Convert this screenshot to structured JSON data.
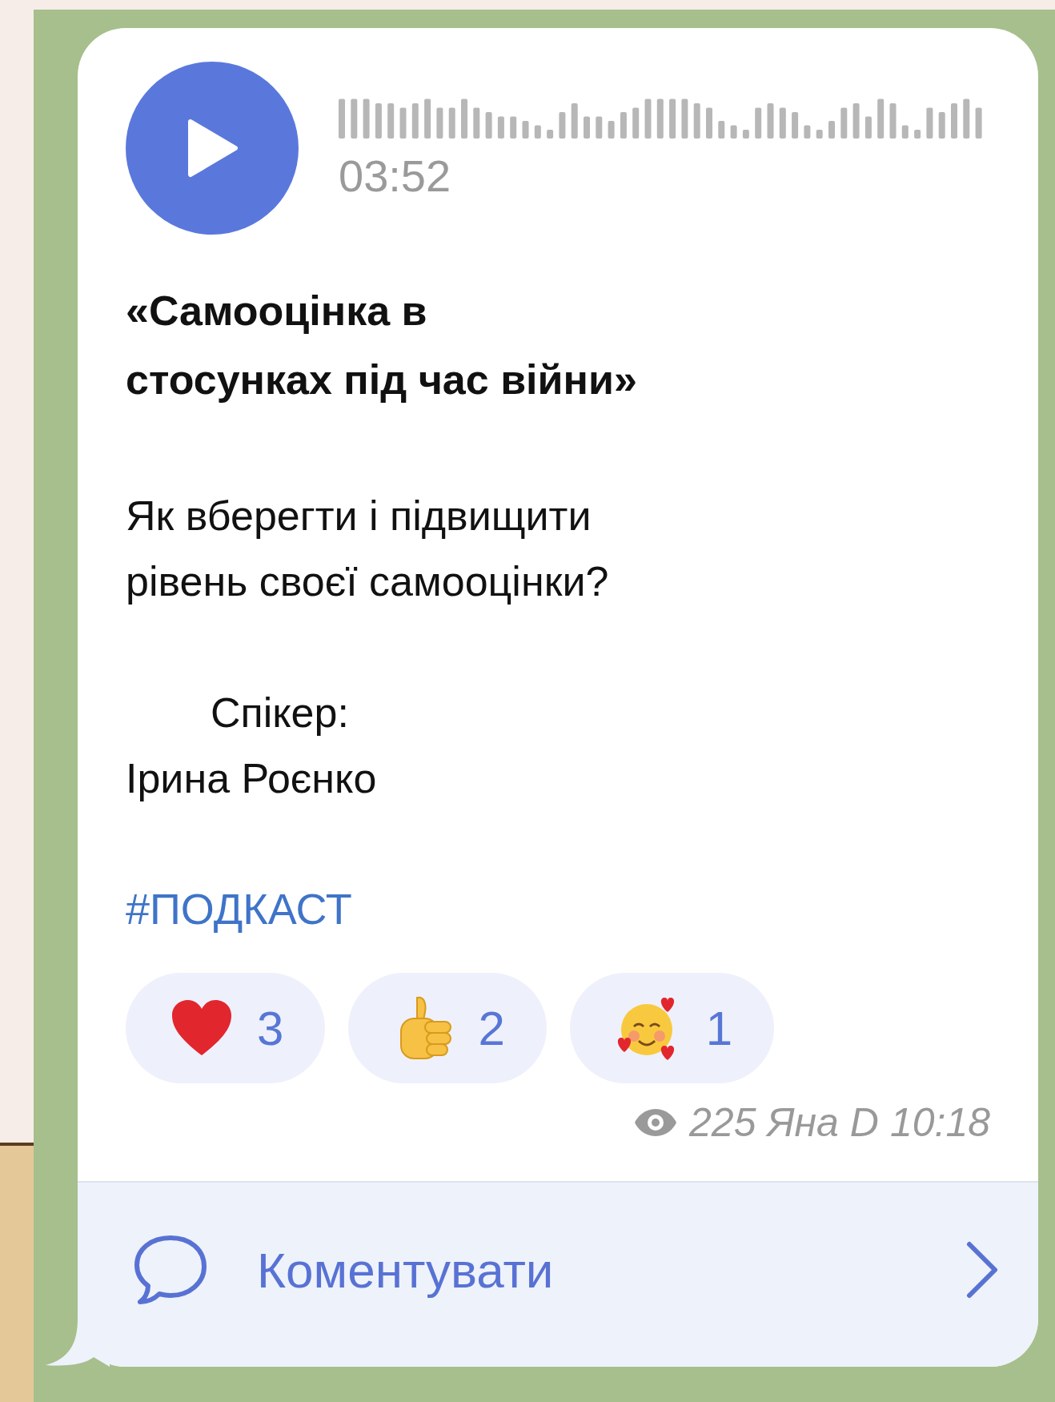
{
  "audio": {
    "duration": "03:52"
  },
  "title_lines": [
    "«Самооцінка в",
    "стосунках під час війни»"
  ],
  "body_lines": [
    "Як вберегти і підвищити",
    "рівень своєї самооцінки?"
  ],
  "speaker": {
    "label": "Спікер:",
    "name": "Ірина Роєнко"
  },
  "hashtag": "#ПОДКАСТ",
  "reactions": [
    {
      "kind": "heart",
      "count": "3"
    },
    {
      "kind": "thumbs_up",
      "count": "2"
    },
    {
      "kind": "smiling_hearts",
      "count": "1"
    }
  ],
  "meta": {
    "views": "225",
    "author": "Яна D",
    "time": "10:18"
  },
  "comment": {
    "label": "Коментувати"
  }
}
